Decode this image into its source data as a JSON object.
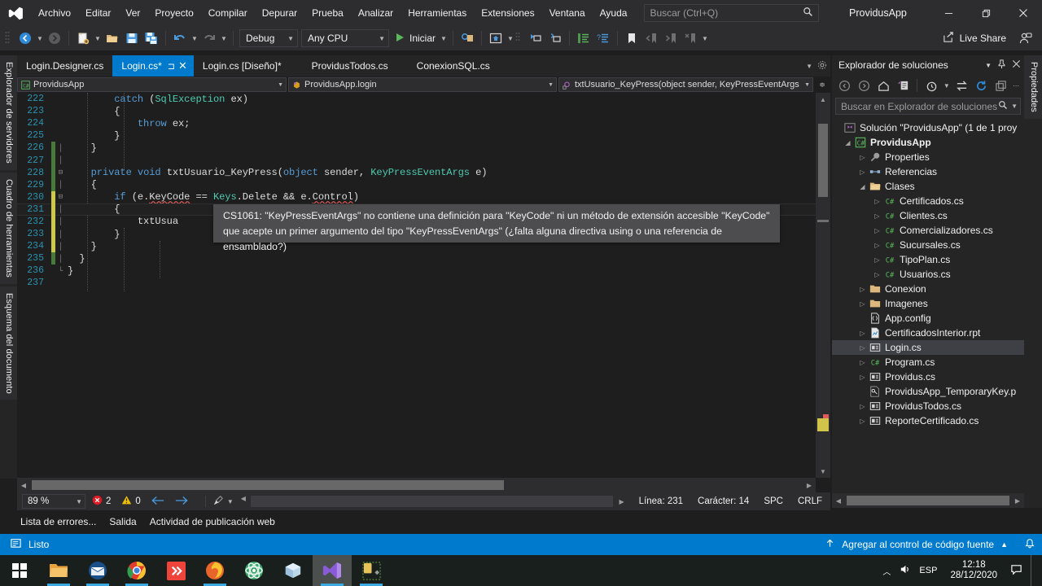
{
  "titlebar": {
    "logo_icon": "visual-studio-logo",
    "menus": [
      "Archivo",
      "Editar",
      "Ver",
      "Proyecto",
      "Compilar",
      "Depurar",
      "Prueba",
      "Analizar",
      "Herramientas",
      "Extensiones",
      "Ventana",
      "Ayuda"
    ],
    "search_placeholder": "Buscar (Ctrl+Q)",
    "search_icon": "search-icon",
    "app_title": "ProvidusApp",
    "minimize_icon": "minimize-icon",
    "restore_icon": "restore-icon",
    "close_icon": "close-icon"
  },
  "toolbar": {
    "back_icon": "navigate-back-icon",
    "forward_icon": "navigate-forward-icon",
    "new_project_icon": "new-project-icon",
    "open_icon": "open-folder-icon",
    "save_icon": "save-icon",
    "save_all_icon": "save-all-icon",
    "undo_icon": "undo-icon",
    "redo_icon": "redo-icon",
    "configuration": "Debug",
    "platform": "Any CPU",
    "start_label": "Iniciar",
    "start_icon": "play-icon",
    "live_share_label": "Live Share",
    "live_share_icon": "live-share-icon",
    "account_icon": "account-presence-icon"
  },
  "left_dock": {
    "tabs": [
      "Explorador de servidores",
      "Cuadro de herramientas",
      "Esquema del documento"
    ]
  },
  "right_dock": {
    "tabs": [
      "Propiedades"
    ]
  },
  "tabs": [
    {
      "label": "Login.Designer.cs",
      "active": false
    },
    {
      "label": "Login.cs*",
      "active": true,
      "pin_icon": "pin-icon",
      "close_icon": "close-icon"
    },
    {
      "label": "Login.cs [Diseño]*",
      "active": false
    },
    {
      "label": "ProvidusTodos.cs",
      "active": false
    },
    {
      "label": "ConexionSQL.cs",
      "active": false
    }
  ],
  "navbar": {
    "project": "ProvidusApp",
    "project_icon": "csharp-project-icon",
    "class": "ProvidusApp.login",
    "class_icon": "class-icon",
    "member": "txtUsuario_KeyPress(object sender, KeyPressEventArgs",
    "member_icon": "method-private-icon"
  },
  "editor": {
    "first_line": 222,
    "lines": [
      {
        "n": 222,
        "text": "        catch (SqlException ex)",
        "glyph": "",
        "fold": ""
      },
      {
        "n": 223,
        "text": "        {",
        "glyph": "",
        "fold": ""
      },
      {
        "n": 224,
        "text": "            throw ex;",
        "glyph": "",
        "fold": ""
      },
      {
        "n": 225,
        "text": "        }",
        "glyph": "",
        "fold": ""
      },
      {
        "n": 226,
        "text": "    }",
        "glyph": "green",
        "fold": ""
      },
      {
        "n": 227,
        "text": "",
        "glyph": "green",
        "fold": ""
      },
      {
        "n": 228,
        "text": "    private void txtUsuario_KeyPress(object sender, KeyPressEventArgs e)",
        "glyph": "green",
        "fold": "minus"
      },
      {
        "n": 229,
        "text": "    {",
        "glyph": "green",
        "fold": ""
      },
      {
        "n": 230,
        "text": "        if (e.KeyCode == Keys.Delete && e.Control)",
        "glyph": "yellow",
        "fold": "minus"
      },
      {
        "n": 231,
        "text": "        {",
        "glyph": "yellow",
        "fold": "",
        "current": true
      },
      {
        "n": 232,
        "text": "            txtUsua",
        "glyph": "yellow",
        "fold": ""
      },
      {
        "n": 233,
        "text": "        }",
        "glyph": "yellow",
        "fold": ""
      },
      {
        "n": 234,
        "text": "    }",
        "glyph": "yellow",
        "fold": ""
      },
      {
        "n": 235,
        "text": "  }",
        "glyph": "green",
        "fold": ""
      },
      {
        "n": 236,
        "text": "}",
        "glyph": "",
        "fold": ""
      },
      {
        "n": 237,
        "text": "",
        "glyph": "",
        "fold": ""
      }
    ],
    "tooltip": "CS1061: \"KeyPressEventArgs\" no contiene una definición para \"KeyCode\" ni un método de extensión accesible \"KeyCode\" que acepte un primer argumento del tipo \"KeyPressEventArgs\" (¿falta alguna directiva using o una referencia de ensamblado?)"
  },
  "editor_status": {
    "zoom": "89 %",
    "error_icon": "error-icon",
    "error_count": "2",
    "warning_icon": "warning-icon",
    "warning_count": "0",
    "prev_icon": "arrow-left-icon",
    "next_icon": "arrow-right-icon",
    "format_icon": "brush-icon",
    "line_label": "Línea: 231",
    "char_label": "Carácter: 14",
    "spaces": "SPC",
    "line_ending": "CRLF"
  },
  "bottom_tabs": [
    "Lista de errores...",
    "Salida",
    "Actividad de publicación web"
  ],
  "solution_explorer": {
    "title": "Explorador de soluciones",
    "dropdown_icon": "chevron-down-icon",
    "pin_icon": "pin-icon",
    "close_icon": "close-icon",
    "toolbar_icons": [
      "navigate-back-icon",
      "navigate-forward-icon",
      "home-icon",
      "pending-changes-icon",
      "history-icon",
      "sync-icon",
      "refresh-icon",
      "collapse-all-icon",
      "overflow-icon"
    ],
    "search_placeholder": "Buscar en Explorador de soluciones",
    "search_icon": "search-icon",
    "search_dropdown_icon": "chevron-down-icon",
    "tree": [
      {
        "label": "Solución \"ProvidusApp\" (1 de 1 proy",
        "icon": "solution-icon",
        "indent": 0,
        "expander": "",
        "bold": false
      },
      {
        "label": "ProvidusApp",
        "icon": "csharp-project-icon",
        "indent": 1,
        "expander": "expanded",
        "bold": true
      },
      {
        "label": "Properties",
        "icon": "wrench-icon",
        "indent": 2,
        "expander": "collapsed",
        "bold": false
      },
      {
        "label": "Referencias",
        "icon": "references-icon",
        "indent": 2,
        "expander": "collapsed",
        "bold": false
      },
      {
        "label": "Clases",
        "icon": "folder-open-icon",
        "indent": 2,
        "expander": "expanded",
        "bold": false
      },
      {
        "label": "Certificados.cs",
        "icon": "csharp-file-icon",
        "indent": 3,
        "expander": "collapsed",
        "bold": false
      },
      {
        "label": "Clientes.cs",
        "icon": "csharp-file-icon",
        "indent": 3,
        "expander": "collapsed",
        "bold": false
      },
      {
        "label": "Comercializadores.cs",
        "icon": "csharp-file-icon",
        "indent": 3,
        "expander": "collapsed",
        "bold": false
      },
      {
        "label": "Sucursales.cs",
        "icon": "csharp-file-icon",
        "indent": 3,
        "expander": "collapsed",
        "bold": false
      },
      {
        "label": "TipoPlan.cs",
        "icon": "csharp-file-icon",
        "indent": 3,
        "expander": "collapsed",
        "bold": false
      },
      {
        "label": "Usuarios.cs",
        "icon": "csharp-file-icon",
        "indent": 3,
        "expander": "collapsed",
        "bold": false
      },
      {
        "label": "Conexion",
        "icon": "folder-icon",
        "indent": 2,
        "expander": "collapsed",
        "bold": false
      },
      {
        "label": "Imagenes",
        "icon": "folder-icon",
        "indent": 2,
        "expander": "collapsed",
        "bold": false
      },
      {
        "label": "App.config",
        "icon": "config-file-icon",
        "indent": 2,
        "expander": "",
        "bold": false
      },
      {
        "label": "CertificadosInterior.rpt",
        "icon": "report-file-icon",
        "indent": 2,
        "expander": "collapsed",
        "bold": false
      },
      {
        "label": "Login.cs",
        "icon": "form-file-icon",
        "indent": 2,
        "expander": "collapsed",
        "bold": false,
        "selected": true
      },
      {
        "label": "Program.cs",
        "icon": "csharp-file-icon",
        "indent": 2,
        "expander": "collapsed",
        "bold": false
      },
      {
        "label": "Providus.cs",
        "icon": "form-file-icon",
        "indent": 2,
        "expander": "collapsed",
        "bold": false
      },
      {
        "label": "ProvidusApp_TemporaryKey.p",
        "icon": "key-file-icon",
        "indent": 2,
        "expander": "",
        "bold": false
      },
      {
        "label": "ProvidusTodos.cs",
        "icon": "form-file-icon",
        "indent": 2,
        "expander": "collapsed",
        "bold": false
      },
      {
        "label": "ReporteCertificado.cs",
        "icon": "form-file-icon",
        "indent": 2,
        "expander": "collapsed",
        "bold": false
      }
    ]
  },
  "status_bar": {
    "ready_icon": "ready-icon",
    "ready_label": "Listo",
    "source_control_icon": "arrow-up-icon",
    "source_control_label": "Agregar al control de código fuente",
    "source_control_caret": "chevron-up-icon",
    "notification_icon": "bell-icon"
  },
  "taskbar": {
    "items": [
      {
        "name": "start-button",
        "icon": "windows-logo"
      },
      {
        "name": "file-explorer",
        "icon": "folder-icon"
      },
      {
        "name": "mail-app",
        "icon": "mail-icon"
      },
      {
        "name": "google-chrome",
        "icon": "chrome-icon"
      },
      {
        "name": "anydesk",
        "icon": "anydesk-icon"
      },
      {
        "name": "firefox",
        "icon": "firefox-icon"
      },
      {
        "name": "atom-editor",
        "icon": "atom-icon"
      },
      {
        "name": "3d-viewer",
        "icon": "cube-icon"
      },
      {
        "name": "visual-studio",
        "icon": "visual-studio-logo"
      },
      {
        "name": "sql-tool",
        "icon": "sql-tools-icon"
      }
    ],
    "tray": {
      "chevron_icon": "chevron-up-icon",
      "volume_icon": "volume-icon",
      "language": "ESP",
      "time": "12:18",
      "date": "28/12/2020",
      "notification_icon": "notification-icon"
    }
  },
  "colors": {
    "accent": "#007acc",
    "chrome": "#2d2d30",
    "panel": "#252526",
    "editor_bg": "#1e1e1e",
    "keyword": "#569cd6",
    "type": "#4ec9b0",
    "linenum": "#2b91af",
    "error": "#e05c5c"
  }
}
